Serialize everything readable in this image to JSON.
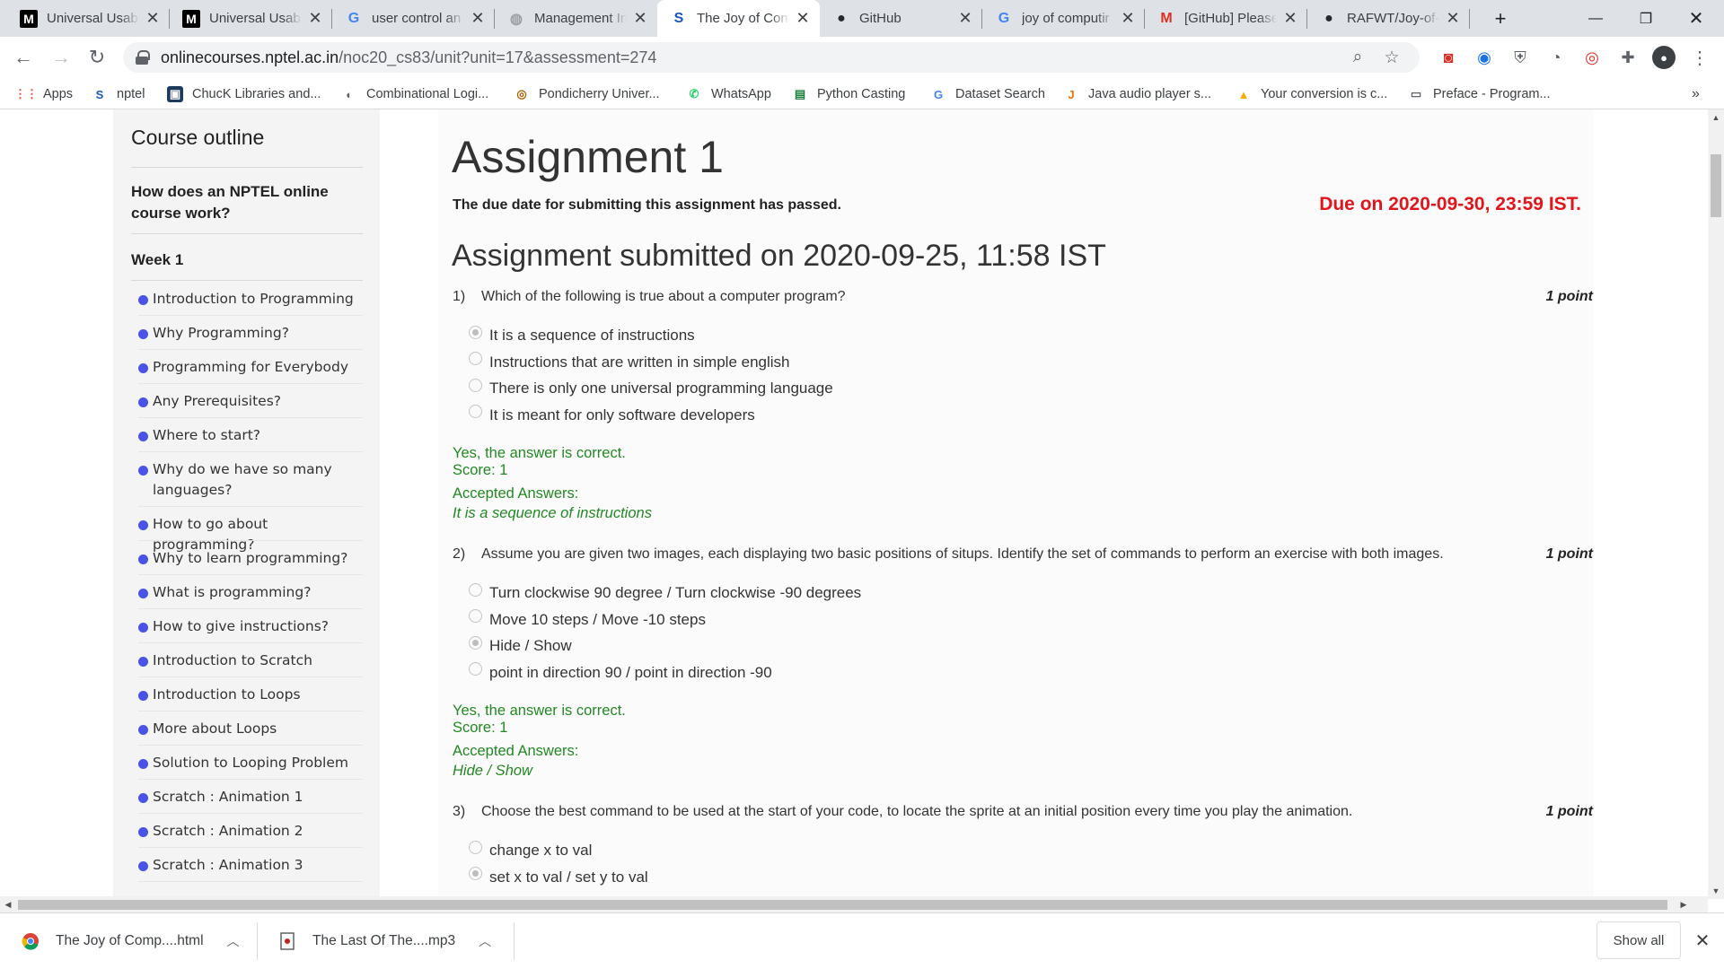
{
  "tabs": [
    {
      "favicon": "medium-icon",
      "glyph": "M",
      "title": "Universal Usabi",
      "active": false
    },
    {
      "favicon": "medium-icon",
      "glyph": "M",
      "title": "Universal Usabi",
      "active": false
    },
    {
      "favicon": "google-icon",
      "glyph": "G",
      "title": "user control an",
      "active": false
    },
    {
      "favicon": "globe-icon",
      "glyph": "◍",
      "title": "Management In",
      "active": false
    },
    {
      "favicon": "swayam-icon",
      "glyph": "S",
      "title": "The Joy of Com",
      "active": true
    },
    {
      "favicon": "github-icon",
      "glyph": "●",
      "title": "GitHub",
      "active": false
    },
    {
      "favicon": "google-icon",
      "glyph": "G",
      "title": "joy of computir",
      "active": false
    },
    {
      "favicon": "gmail-icon",
      "glyph": "M",
      "title": "[GitHub] Please",
      "active": false
    },
    {
      "favicon": "github-icon",
      "glyph": "●",
      "title": "RAFWT/Joy-of-",
      "active": false
    }
  ],
  "address": {
    "host": "onlinecourses.nptel.ac.in",
    "path": "/noc20_cs83/unit?unit=17&assessment=274"
  },
  "bookmarks": [
    {
      "icon": "apps-grid-icon",
      "glyph": "⋮⋮",
      "label": "Apps"
    },
    {
      "icon": "swayam-icon",
      "glyph": "S",
      "label": "nptel"
    },
    {
      "icon": "library-icon",
      "glyph": "▣",
      "label": "ChucK Libraries and..."
    },
    {
      "icon": "globe-icon",
      "glyph": "◐",
      "label": "Combinational Logi..."
    },
    {
      "icon": "university-icon",
      "glyph": "◎",
      "label": "Pondicherry Univer..."
    },
    {
      "icon": "whatsapp-icon",
      "glyph": "✆",
      "label": "WhatsApp"
    },
    {
      "icon": "python-icon",
      "glyph": "▤",
      "label": "Python Casting"
    },
    {
      "icon": "google-icon",
      "glyph": "G",
      "label": "Dataset Search"
    },
    {
      "icon": "java-icon",
      "glyph": "J",
      "label": "Java audio player s..."
    },
    {
      "icon": "convert-icon",
      "glyph": "▲",
      "label": "Your conversion is c..."
    },
    {
      "icon": "book-icon",
      "glyph": "▭",
      "label": "Preface - Program..."
    }
  ],
  "sidebar": {
    "title": "Course outline",
    "intro": "How does an NPTEL online course work?",
    "week": "Week 1",
    "lessons": [
      "Introduction to Programming",
      "Why Programming?",
      "Programming for Everybody",
      "Any Prerequisites?",
      "Where to start?",
      "Why do we have so many languages?",
      "How to go about programming?",
      "Why to learn programming?",
      "What is programming?",
      "How to give instructions?",
      "Introduction to Scratch",
      "Introduction to Loops",
      "More about Loops",
      "Solution to Looping Problem",
      "Scratch : Animation 1",
      "Scratch : Animation 2",
      "Scratch : Animation 3"
    ]
  },
  "assignment": {
    "title": "Assignment 1",
    "passed_notice": "The due date for submitting this assignment has passed.",
    "due": "Due on 2020-09-30, 23:59 IST.",
    "submitted": "Assignment submitted on 2020-09-25, 11:58 IST",
    "questions": [
      {
        "number": "1)",
        "text": "Which of the following is true about a computer program?",
        "points": "1 point",
        "options": [
          "It is a sequence of instructions",
          "Instructions that are written in simple english",
          "There is only one universal programming language",
          "It is meant for only software developers"
        ],
        "selected": 0,
        "result": "Yes, the answer is correct.",
        "score": "Score: 1",
        "accepted_label": "Accepted Answers:",
        "accepted": "It is a sequence of instructions"
      },
      {
        "number": "2)",
        "text": "Assume you are given two images, each displaying two basic positions of situps. Identify the set of commands to perform an exercise with both images.",
        "points": "1 point",
        "options": [
          "Turn clockwise 90 degree / Turn clockwise -90 degrees",
          "Move 10 steps / Move -10 steps",
          "Hide / Show",
          "point in direction 90 / point in direction -90"
        ],
        "selected": 2,
        "result": "Yes, the answer is correct.",
        "score": "Score: 1",
        "accepted_label": "Accepted Answers:",
        "accepted": "Hide / Show"
      },
      {
        "number": "3)",
        "text": "Choose the best command to be used at the start of your code, to locate the sprite at an initial position every time you play the animation.",
        "points": "1 point",
        "options": [
          "change x to val",
          "set x to val / set y to val"
        ],
        "selected": 1
      }
    ]
  },
  "downloads": [
    {
      "icon": "chrome-icon",
      "name": "The Joy of Comp....html"
    },
    {
      "icon": "audio-file-icon",
      "name": "The Last Of The....mp3"
    }
  ],
  "show_all": "Show all",
  "colors": {
    "due_red": "#e0161c",
    "correct_green": "#238823",
    "lesson_dot": "#4a52e8"
  }
}
